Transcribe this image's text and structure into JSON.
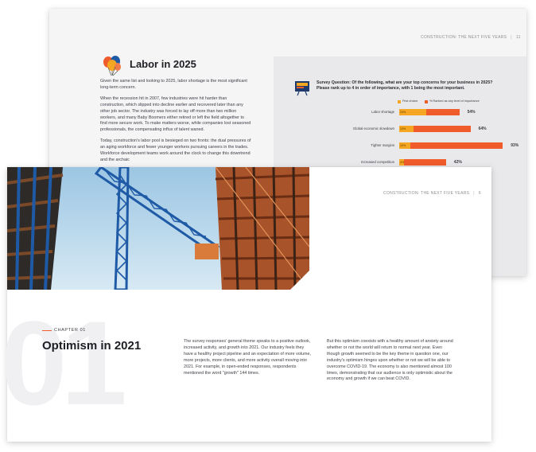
{
  "back_page": {
    "header": {
      "running_title": "CONSTRUCTION: THE NEXT FIVE YEARS",
      "page_number": "11"
    },
    "section_title": "Labor in 2025",
    "paragraphs": [
      "Given the same list and looking to 2025, labor shortage is the most significant long-term concern.",
      "When the recession hit in 2007, few industries were hit harder than construction, which slipped into decline earlier and recovered later than any other job sector. The industry was forced to lay off more than two million workers, and many Baby Boomers either retired or left the field altogether to find more secure work. To make matters worse, while companies lost seasoned professionals, the compensating influx of talent waned.",
      "Today, construction's labor pool is besieged on two fronts: the dual pressures of an aging workforce and fewer younger workers pursuing careers in the trades. Workforce development teams work around the clock to change this downtrend and the archaic"
    ],
    "survey_question": "Survey Question: Of the following, what are your top concerns for your business in 2025? Please rank up to 4 in order of importance, with 1 being the most important.",
    "colors": {
      "first_choice": "#f5a623",
      "ranked": "#ef5b2b"
    }
  },
  "chart_data": {
    "type": "bar",
    "orientation": "horizontal",
    "stacked": true,
    "categories": [
      "Labor shortage",
      "Global economic slowdown",
      "Tighter margins",
      "Increased competition"
    ],
    "series": [
      {
        "name": "First choice",
        "values": [
          24,
          13,
          10,
          4
        ]
      },
      {
        "name": "% Ranked as any level of importance",
        "values": [
          54,
          64,
          93,
          42
        ]
      }
    ],
    "data_labels": [
      "54%",
      "64%",
      "93%",
      "42%"
    ],
    "first_labels": [
      "24%",
      "13%",
      "10%",
      "4%"
    ],
    "legend": [
      "First choice",
      "% Ranked as any level of importance"
    ],
    "xlim": [
      0,
      100
    ]
  },
  "front_page": {
    "header": {
      "running_title": "CONSTRUCTION: THE NEXT FIVE YEARS",
      "page_number": "6"
    },
    "chapter_label": "CHAPTER 01",
    "chapter_number": "01",
    "title": "Optimism in 2021",
    "column_1": "The survey responses' general theme speaks to a positive outlook, increased activity, and growth into 2021. Our industry feels they have a healthy project pipeline and an expectation of more volume, more projects, more clients, and more activity overall moving into 2021. For example, in open-ended responses, respondents mentioned the word \"growth\" 144 times.",
    "column_2": "But this optimism coexists with a healthy amount of anxiety around whether or not the world will return to normal next year. Even though growth seemed to be the key theme in question one, our industry's optimism hinges upon whether or not we will be able to overcome COVID-19. The economy is also mentioned almost 100 times, demonstrating that our audience is only optimistic about the economy and growth if we can beat COVID."
  }
}
